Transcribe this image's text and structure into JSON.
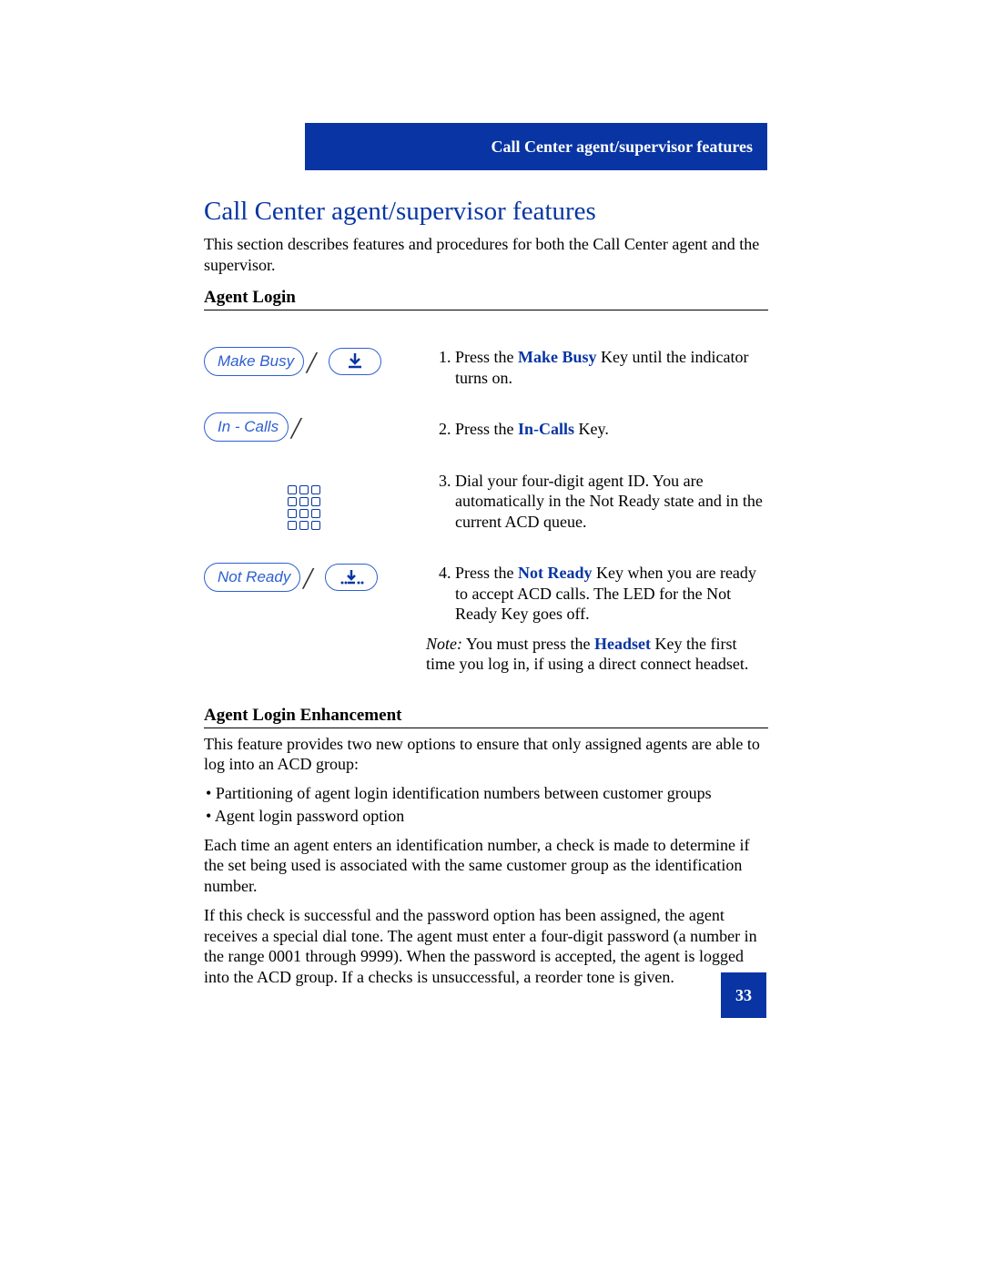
{
  "header": {
    "running_title": "Call Center agent/supervisor features"
  },
  "main": {
    "title": "Call Center agent/supervisor features",
    "intro": "This section describes features and procedures for both the Call Center agent and the supervisor.",
    "section1_heading": "Agent Login",
    "keys": {
      "make_busy": "Make Busy",
      "in_calls": "In - Calls",
      "not_ready": "Not Ready"
    },
    "steps": {
      "s1_pre": "Press the ",
      "s1_kw": "Make Busy",
      "s1_post": " Key until the indicator turns on.",
      "s2_pre": "Press the ",
      "s2_kw": "In-Calls",
      "s2_post": " Key.",
      "s3": "Dial your four-digit agent ID. You are automatically in the Not Ready state and in the current ACD queue.",
      "s4_pre": "Press the ",
      "s4_kw": "Not Ready",
      "s4_post": " Key when you are ready to accept ACD calls. The LED for the Not Ready Key goes off."
    },
    "note": {
      "label": "Note:",
      "pre": " You must press the ",
      "kw": "Headset",
      "post": " Key the first time you log in, if using a direct connect headset."
    },
    "section2_heading": "Agent Login Enhancement",
    "enh_intro": "This feature provides two new options to ensure that only assigned agents are able to log into an ACD group:",
    "enh_bullets": [
      "Partitioning of agent login identification numbers between customer groups",
      "Agent login password option"
    ],
    "enh_p1": "Each time an agent enters an identification number, a check is made to determine if the set being used is associated with the same customer group as the identification number.",
    "enh_p2": "If this check is successful and the password option has been assigned, the agent receives a special dial tone. The agent must enter a four-digit password (a number in the range 0001 through 9999). When the password is accepted, the agent is logged into the ACD group. If a checks is unsuccessful, a reorder tone is given."
  },
  "page_number": "33"
}
